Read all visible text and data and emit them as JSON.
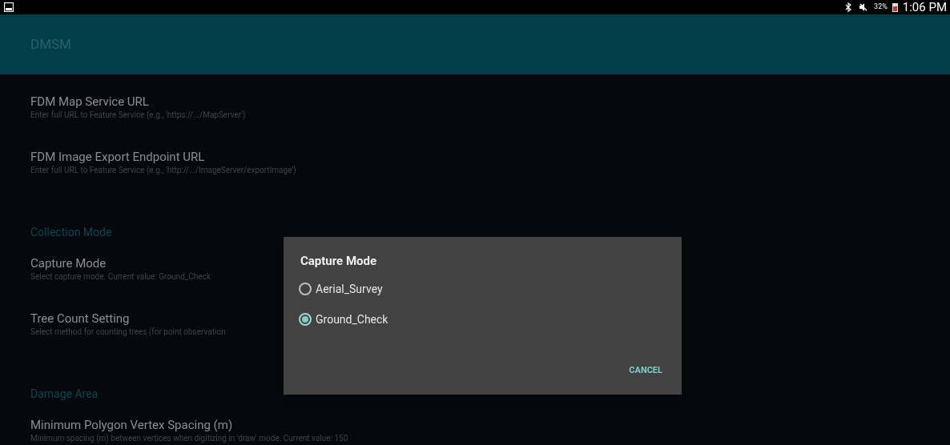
{
  "status_bar": {
    "battery": "32%",
    "time": "1:06 PM"
  },
  "app_bar": {
    "title": "DMSM"
  },
  "preferences": [
    {
      "kind": "item",
      "title": "FDM Map Service URL",
      "summary": "Enter full URL to Feature Service (e.g., 'https://.../MapServer')"
    },
    {
      "kind": "item",
      "title": "FDM Image Export Endpoint URL",
      "summary": "Enter full URL to Feature Service (e.g., 'http://.../ImageServer/exportImage')"
    },
    {
      "kind": "header",
      "title": "Collection Mode"
    },
    {
      "kind": "item",
      "title": "Capture Mode",
      "summary": "Select capture mode.  Current value: Ground_Check"
    },
    {
      "kind": "item",
      "title": "Tree Count Setting",
      "summary": "Select method for counting trees (for point observation"
    },
    {
      "kind": "header",
      "title": "Damage Area"
    },
    {
      "kind": "item",
      "title": "Minimum Polygon Vertex Spacing (m)",
      "summary": "Minimum spacing (m) between vertices when digitizing in 'draw' mode.  Current value: 150"
    }
  ],
  "dialog": {
    "title": "Capture Mode",
    "options": [
      {
        "label": "Aerial_Survey",
        "selected": false
      },
      {
        "label": "Ground_Check",
        "selected": true
      }
    ],
    "button": "CANCEL"
  }
}
